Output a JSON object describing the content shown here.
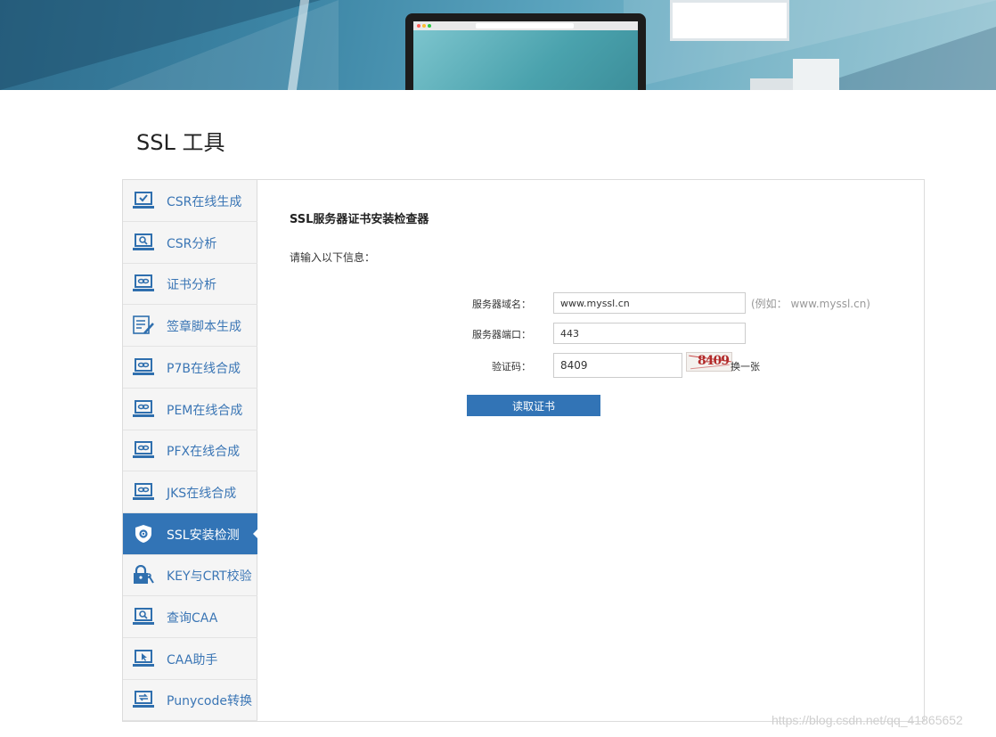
{
  "page": {
    "title": "SSL 工具"
  },
  "sidebar": {
    "items": [
      {
        "label": "CSR在线生成",
        "icon": "laptop-check-icon"
      },
      {
        "label": "CSR分析",
        "icon": "laptop-search-icon"
      },
      {
        "label": "证书分析",
        "icon": "laptop-link-icon"
      },
      {
        "label": "签章脚本生成",
        "icon": "document-edit-icon"
      },
      {
        "label": "P7B在线合成",
        "icon": "laptop-link-icon"
      },
      {
        "label": "PEM在线合成",
        "icon": "laptop-link-icon"
      },
      {
        "label": "PFX在线合成",
        "icon": "laptop-link-icon"
      },
      {
        "label": "JKS在线合成",
        "icon": "laptop-link-icon"
      },
      {
        "label": "SSL安装检测",
        "icon": "shield-gear-icon",
        "active": true
      },
      {
        "label": "KEY与CRT校验",
        "icon": "lock-key-icon"
      },
      {
        "label": "查询CAA",
        "icon": "laptop-search-icon"
      },
      {
        "label": "CAA助手",
        "icon": "laptop-pointer-icon"
      },
      {
        "label": "Punycode转换",
        "icon": "laptop-convert-icon"
      }
    ]
  },
  "content": {
    "heading": "SSL服务器证书安装检查器",
    "intro": "请输入以下信息：",
    "domain_label": "服务器域名：",
    "domain_value": "www.myssl.cn",
    "domain_hint": "(例如： www.myssl.cn)",
    "port_label": "服务器端口：",
    "port_value": "443",
    "captcha_label": "验证码：",
    "captcha_value": "8409",
    "captcha_image_text": "8409",
    "refresh_label": "换一张",
    "submit_label": "读取证书"
  },
  "watermark": "https://blog.csdn.net/qq_41865652",
  "colors": {
    "accent": "#3274b6",
    "link": "#3b76b5",
    "sidebar_bg": "#f5f5f5"
  }
}
